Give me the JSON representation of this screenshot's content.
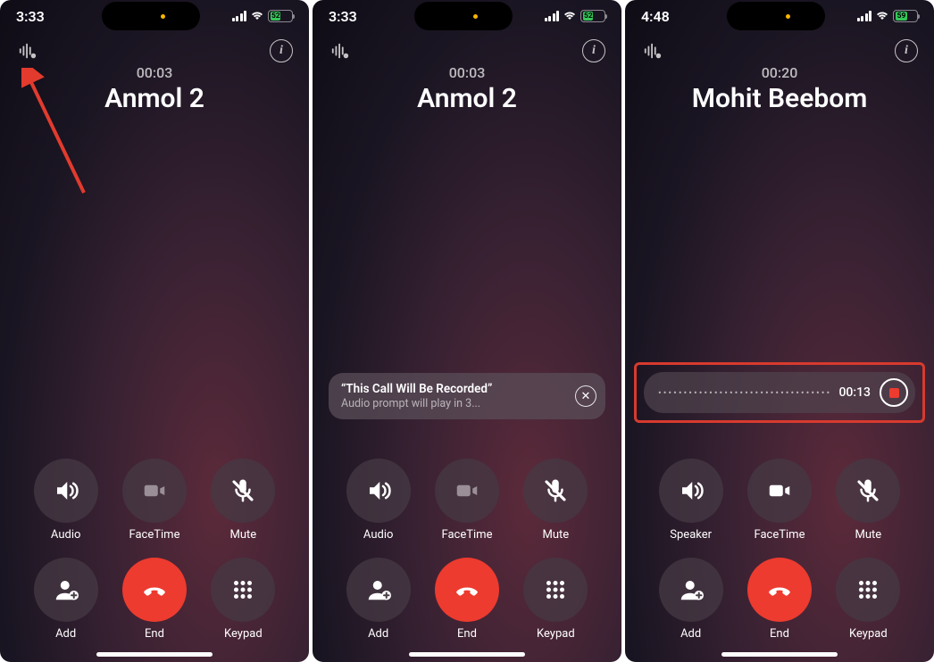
{
  "shots": [
    {
      "status": {
        "time": "3:33",
        "battery_text": "52",
        "battery_pct": 52
      },
      "call": {
        "timer": "00:03",
        "name": "Anmol 2"
      },
      "arrow": true,
      "toast": null,
      "recording": null,
      "buttons": [
        {
          "key": "audio",
          "label": "Audio",
          "icon": "speaker"
        },
        {
          "key": "facetime",
          "label": "FaceTime",
          "icon": "facetime"
        },
        {
          "key": "mute",
          "label": "Mute",
          "icon": "mute"
        },
        {
          "key": "add",
          "label": "Add",
          "icon": "add"
        },
        {
          "key": "end",
          "label": "End",
          "icon": "end"
        },
        {
          "key": "keypad",
          "label": "Keypad",
          "icon": "keypad"
        }
      ]
    },
    {
      "status": {
        "time": "3:33",
        "battery_text": "52",
        "battery_pct": 52
      },
      "call": {
        "timer": "00:03",
        "name": "Anmol 2"
      },
      "arrow": false,
      "toast": {
        "title": "“This Call Will Be Recorded”",
        "subtitle": "Audio prompt will play in 3..."
      },
      "recording": null,
      "buttons": [
        {
          "key": "audio",
          "label": "Audio",
          "icon": "speaker"
        },
        {
          "key": "facetime",
          "label": "FaceTime",
          "icon": "facetime"
        },
        {
          "key": "mute",
          "label": "Mute",
          "icon": "mute"
        },
        {
          "key": "add",
          "label": "Add",
          "icon": "add"
        },
        {
          "key": "end",
          "label": "End",
          "icon": "end"
        },
        {
          "key": "keypad",
          "label": "Keypad",
          "icon": "keypad"
        }
      ]
    },
    {
      "status": {
        "time": "4:48",
        "battery_text": "59",
        "battery_pct": 59
      },
      "call": {
        "timer": "00:20",
        "name": "Mohit Beebom"
      },
      "arrow": false,
      "toast": null,
      "recording": {
        "elapsed": "00:13",
        "highlight": true
      },
      "buttons": [
        {
          "key": "speaker",
          "label": "Speaker",
          "icon": "speaker"
        },
        {
          "key": "facetime",
          "label": "FaceTime",
          "icon": "facetime-on"
        },
        {
          "key": "mute",
          "label": "Mute",
          "icon": "mute"
        },
        {
          "key": "add",
          "label": "Add",
          "icon": "add"
        },
        {
          "key": "end",
          "label": "End",
          "icon": "end"
        },
        {
          "key": "keypad",
          "label": "Keypad",
          "icon": "keypad"
        }
      ]
    }
  ]
}
